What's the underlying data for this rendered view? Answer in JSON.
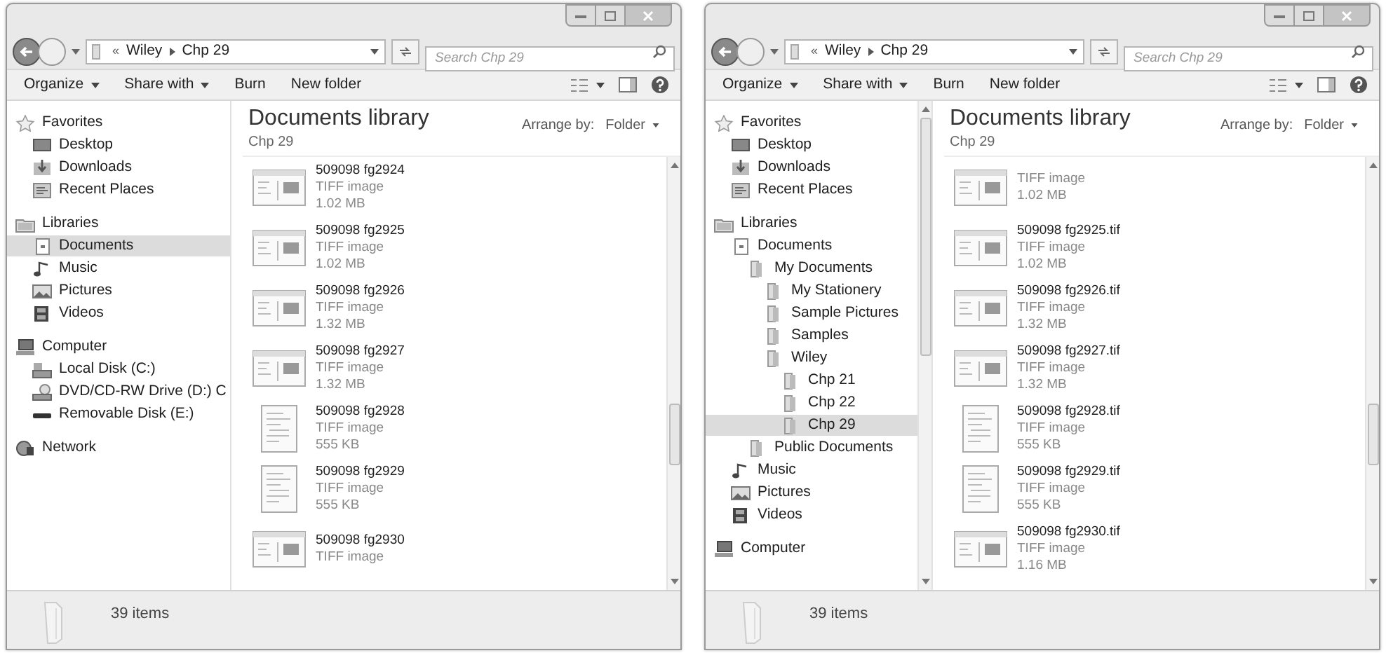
{
  "windows": [
    {
      "address": {
        "overflow": "«",
        "crumbs": [
          "Wiley",
          "Chp 29"
        ]
      },
      "search": {
        "placeholder": "Search Chp 29"
      },
      "toolbar": [
        {
          "label": "Organize",
          "dropdown": true
        },
        {
          "label": "Share with",
          "dropdown": true
        },
        {
          "label": "Burn",
          "dropdown": false
        },
        {
          "label": "New folder",
          "dropdown": false
        }
      ],
      "library": {
        "title": "Documents library",
        "subtitle": "Chp 29",
        "arrange_label": "Arrange by:",
        "arrange_value": "Folder"
      },
      "nav": [
        {
          "label": "Favorites",
          "kind": "star",
          "selected": false,
          "children": [
            {
              "label": "Desktop",
              "kind": "desktop",
              "selected": false
            },
            {
              "label": "Downloads",
              "kind": "download",
              "selected": false
            },
            {
              "label": "Recent Places",
              "kind": "recent",
              "selected": false
            }
          ]
        },
        {
          "label": "Libraries",
          "kind": "library",
          "selected": false,
          "children": [
            {
              "label": "Documents",
              "kind": "document",
              "selected": true
            },
            {
              "label": "Music",
              "kind": "music",
              "selected": false
            },
            {
              "label": "Pictures",
              "kind": "picture",
              "selected": false
            },
            {
              "label": "Videos",
              "kind": "video",
              "selected": false
            }
          ]
        },
        {
          "label": "Computer",
          "kind": "computer",
          "selected": false,
          "children": [
            {
              "label": "Local Disk (C:)",
              "kind": "disk",
              "selected": false
            },
            {
              "label": "DVD/CD-RW Drive (D:) C",
              "kind": "dvd",
              "selected": false
            },
            {
              "label": "Removable Disk (E:)",
              "kind": "removable",
              "selected": false
            }
          ]
        },
        {
          "label": "Network",
          "kind": "network",
          "selected": false
        }
      ],
      "files": [
        {
          "name": "509098 fg2924",
          "type": "TIFF image",
          "size": "1.02 MB",
          "kind": "landscape"
        },
        {
          "name": "509098 fg2925",
          "type": "TIFF image",
          "size": "1.02 MB",
          "kind": "landscape"
        },
        {
          "name": "509098 fg2926",
          "type": "TIFF image",
          "size": "1.32 MB",
          "kind": "landscape"
        },
        {
          "name": "509098 fg2927",
          "type": "TIFF image",
          "size": "1.32 MB",
          "kind": "landscape"
        },
        {
          "name": "509098 fg2928",
          "type": "TIFF image",
          "size": "555 KB",
          "kind": "portrait"
        },
        {
          "name": "509098 fg2929",
          "type": "TIFF image",
          "size": "555 KB",
          "kind": "portrait"
        },
        {
          "name": "509098 fg2930",
          "type": "TIFF image",
          "kind": "landscape"
        }
      ],
      "status": "39 items"
    },
    {
      "address": {
        "overflow": "«",
        "crumbs": [
          "Wiley",
          "Chp 29"
        ]
      },
      "search": {
        "placeholder": "Search Chp 29"
      },
      "toolbar": [
        {
          "label": "Organize",
          "dropdown": true
        },
        {
          "label": "Share with",
          "dropdown": true
        },
        {
          "label": "Burn",
          "dropdown": false
        },
        {
          "label": "New folder",
          "dropdown": false
        }
      ],
      "library": {
        "title": "Documents library",
        "subtitle": "Chp 29",
        "arrange_label": "Arrange by:",
        "arrange_value": "Folder"
      },
      "nav": [
        {
          "label": "Favorites",
          "kind": "star",
          "selected": false,
          "children": [
            {
              "label": "Desktop",
              "kind": "desktop",
              "selected": false
            },
            {
              "label": "Downloads",
              "kind": "download",
              "selected": false
            },
            {
              "label": "Recent Places",
              "kind": "recent",
              "selected": false
            }
          ]
        },
        {
          "label": "Libraries",
          "kind": "library",
          "selected": false,
          "children": [
            {
              "label": "Documents",
              "kind": "document",
              "selected": false,
              "children": [
                {
                  "label": "My Documents",
                  "kind": "folder",
                  "selected": false,
                  "children": [
                    {
                      "label": "My Stationery",
                      "kind": "folder",
                      "selected": false
                    },
                    {
                      "label": "Sample Pictures",
                      "kind": "folder",
                      "selected": false
                    },
                    {
                      "label": "Samples",
                      "kind": "folder",
                      "selected": false
                    },
                    {
                      "label": "Wiley",
                      "kind": "folder",
                      "selected": false,
                      "children": [
                        {
                          "label": "Chp 21",
                          "kind": "folder",
                          "selected": false
                        },
                        {
                          "label": "Chp 22",
                          "kind": "folder",
                          "selected": false
                        },
                        {
                          "label": "Chp 29",
                          "kind": "folder",
                          "selected": true
                        }
                      ]
                    }
                  ]
                },
                {
                  "label": "Public Documents",
                  "kind": "folder",
                  "selected": false
                }
              ]
            },
            {
              "label": "Music",
              "kind": "music",
              "selected": false
            },
            {
              "label": "Pictures",
              "kind": "picture",
              "selected": false
            },
            {
              "label": "Videos",
              "kind": "video",
              "selected": false
            }
          ]
        },
        {
          "label": "Computer",
          "kind": "computer",
          "selected": false
        }
      ],
      "files": [
        {
          "type": "TIFF image",
          "size": "1.02 MB",
          "kind": "landscape"
        },
        {
          "name": "509098 fg2925.tif",
          "type": "TIFF image",
          "size": "1.02 MB",
          "kind": "landscape"
        },
        {
          "name": "509098 fg2926.tif",
          "type": "TIFF image",
          "size": "1.32 MB",
          "kind": "landscape"
        },
        {
          "name": "509098 fg2927.tif",
          "type": "TIFF image",
          "size": "1.32 MB",
          "kind": "landscape"
        },
        {
          "name": "509098 fg2928.tif",
          "type": "TIFF image",
          "size": "555 KB",
          "kind": "portrait"
        },
        {
          "name": "509098 fg2929.tif",
          "type": "TIFF image",
          "size": "555 KB",
          "kind": "portrait"
        },
        {
          "name": "509098 fg2930.tif",
          "type": "TIFF image",
          "size": "1.16 MB",
          "kind": "landscape"
        }
      ],
      "status": "39 items"
    }
  ]
}
